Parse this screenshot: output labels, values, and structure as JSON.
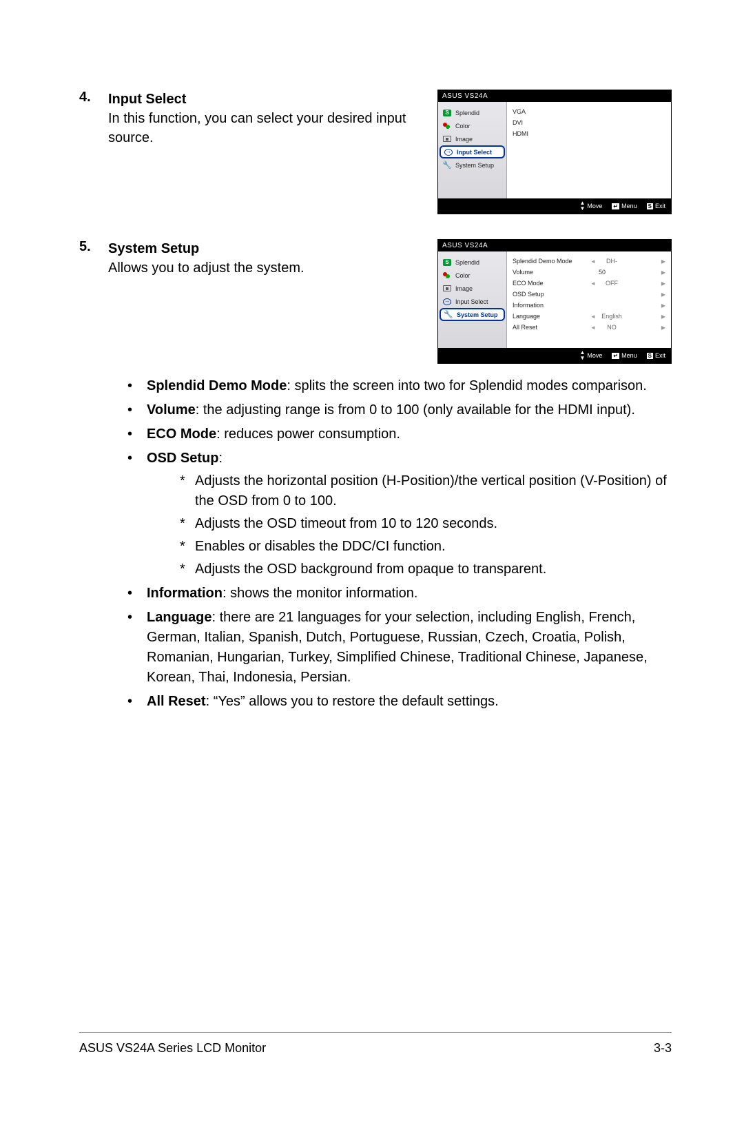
{
  "section4": {
    "num": "4.",
    "title": "Input Select",
    "body": "In this function, you can select your desired input source."
  },
  "section5": {
    "num": "5.",
    "title": "System Setup",
    "body": "Allows you to adjust the system."
  },
  "osd_common": {
    "header": "ASUS VS24A",
    "sidebar": {
      "splendid": "Splendid",
      "color": "Color",
      "image": "Image",
      "input": "Input Select",
      "system": "System Setup"
    },
    "footer": {
      "move": "Move",
      "menu": "Menu",
      "exit": "Exit",
      "menu_badge": "↵",
      "exit_badge": "S"
    }
  },
  "osd1": {
    "options": {
      "vga": "VGA",
      "dvi": "DVI",
      "hdmi": "HDMI"
    }
  },
  "osd2": {
    "rows": {
      "demo": {
        "label": "Splendid Demo Mode",
        "val": "DH-"
      },
      "volume": {
        "label": "Volume",
        "num": "50"
      },
      "eco": {
        "label": "ECO Mode",
        "val": "OFF"
      },
      "osd": {
        "label": "OSD Setup"
      },
      "info": {
        "label": "Information"
      },
      "lang": {
        "label": "Language",
        "val": "English"
      },
      "reset": {
        "label": "All Reset",
        "val": "NO"
      }
    }
  },
  "bullets": {
    "b1_title": "Splendid Demo Mode",
    "b1_body": ": splits the screen into two for Splendid modes comparison.",
    "b2_title": "Volume",
    "b2_body": ": the adjusting range is from 0 to 100 (only available for the HDMI input).",
    "b3_title": "ECO Mode",
    "b3_body": ": reduces power consumption.",
    "b4_title": "OSD Setup",
    "b4_body": ":",
    "b4_s1": "Adjusts the horizontal position (H-Position)/the vertical position (V-Position) of the OSD from 0 to 100.",
    "b4_s2": "Adjusts the OSD timeout from 10 to 120 seconds.",
    "b4_s3": "Enables or disables the DDC/CI function.",
    "b4_s4": "Adjusts the OSD background from opaque to transparent.",
    "b5_title": "Information",
    "b5_body": ": shows the monitor information.",
    "b6_title": "Language",
    "b6_body": ": there are 21 languages for your selection, including English, French, German, Italian, Spanish, Dutch, Portuguese, Russian, Czech, Croatia, Polish, Romanian, Hungarian, Turkey, Simplified Chinese, Traditional Chinese, Japanese, Korean, Thai, Indonesia, Persian.",
    "b7_title": "All Reset",
    "b7_body": ": “Yes” allows you to restore the default settings."
  },
  "footer": {
    "left": "ASUS VS24A Series LCD Monitor",
    "right": "3-3"
  }
}
